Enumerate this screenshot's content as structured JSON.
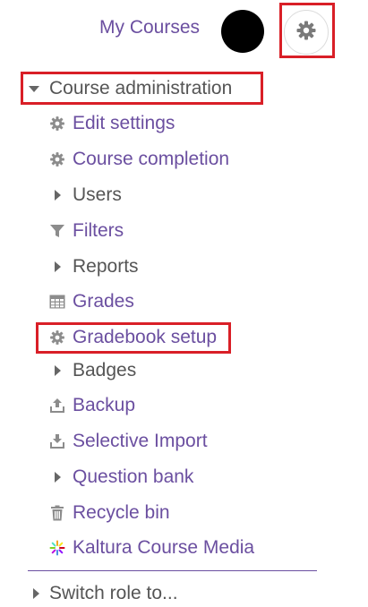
{
  "header": {
    "my_courses": "My Courses"
  },
  "admin": {
    "title": "Course administration",
    "items": [
      {
        "label": "Edit settings",
        "icon": "gear-icon"
      },
      {
        "label": "Course completion",
        "icon": "gear-icon"
      },
      {
        "label": "Users",
        "icon": "caret-right-icon"
      },
      {
        "label": "Filters",
        "icon": "filter-icon"
      },
      {
        "label": "Reports",
        "icon": "caret-right-icon"
      },
      {
        "label": "Grades",
        "icon": "table-icon"
      },
      {
        "label": "Gradebook setup",
        "icon": "gear-icon"
      },
      {
        "label": "Badges",
        "icon": "caret-right-icon"
      },
      {
        "label": "Backup",
        "icon": "upload-icon"
      },
      {
        "label": "Selective Import",
        "icon": "download-icon"
      },
      {
        "label": "Question bank",
        "icon": "caret-right-icon"
      },
      {
        "label": "Recycle bin",
        "icon": "trash-icon"
      },
      {
        "label": "Kaltura Course Media",
        "icon": "kaltura-icon"
      }
    ]
  },
  "switch_role": "Switch role to...",
  "colors": {
    "link": "#6b4fa0",
    "text": "#555555",
    "highlight": "#d91f27",
    "icon": "#8c8c8c"
  }
}
